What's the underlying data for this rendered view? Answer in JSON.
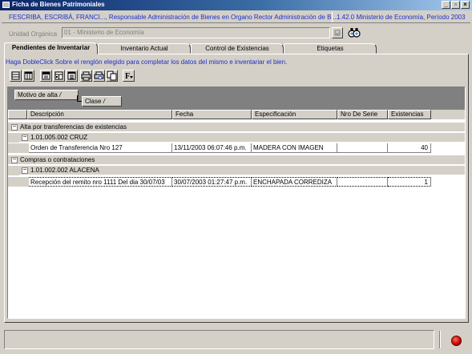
{
  "window": {
    "title": "Ficha de Bienes Patrimoniales",
    "minimize": "_",
    "restore": "▫",
    "close": "×"
  },
  "info": {
    "user": "FESCRIBA, ESCRIBÁ, FRANCI..., Responsable Administración de Bienes en Organo Rector Administración de Bi...",
    "version": "1.42.0 Ministerio de Economía, Período 2003"
  },
  "unidad": {
    "label": "Unidad Orgánica",
    "value": "01 - Ministerio de Economía"
  },
  "tabs": [
    {
      "label": "Pendientes de Inventariar",
      "active": true
    },
    {
      "label": "Inventario Actual",
      "active": false
    },
    {
      "label": "Control de Existencias",
      "active": false
    },
    {
      "label": "Etiquetas",
      "active": false
    }
  ],
  "hint": "Haga DobleClick Sobre el renglón elegido para completar los datos del mismo e inventariar el bien.",
  "toolbar_icons": [
    "grid-view-icon",
    "columns-icon",
    "expand-icon",
    "collapse-icon",
    "export-icon",
    "print-icon",
    "print-preview-icon",
    "copy-icon",
    "filter-icon"
  ],
  "groupby": {
    "first": "Motivo de alta",
    "second": "Clase",
    "sort_glyph": "/"
  },
  "columns": [
    "Descripción",
    "Fecha",
    "Especificación",
    "Nro De Serie",
    "Existencias"
  ],
  "groups": [
    {
      "label": "Alta por transferencias de existencias",
      "subgroups": [
        {
          "label": "1.01.005.002 CRUZ",
          "rows": [
            {
              "descripcion": "Orden de Transferencia Nro 127",
              "fecha": "13/11/2003 06:07:46 p.m.",
              "especificacion": "MADERA CON IMAGEN",
              "serie": "",
              "existencias": "40"
            }
          ]
        }
      ]
    },
    {
      "label": "Compras o contrataciones",
      "subgroups": [
        {
          "label": "1.01.002.002 ALACENA",
          "rows": [
            {
              "descripcion": "Recepción del remito nro 1111 Del dia 30/07/03",
              "fecha": "30/07/2003 01:27:47 p.m.",
              "especificacion": "ENCHAPADA CORREDIZA",
              "serie": "",
              "existencias": "1"
            }
          ]
        }
      ]
    }
  ],
  "expander_glyph": "−",
  "colors": {
    "accent_text": "#1a2fc8",
    "title_start": "#0a246a",
    "status_light": "#c80000"
  }
}
